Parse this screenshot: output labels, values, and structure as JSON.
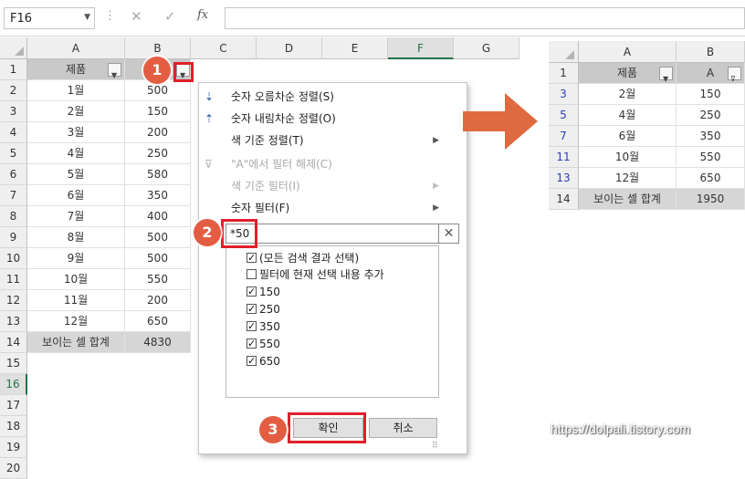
{
  "formula_bar": {
    "namebox": "F16",
    "fx": "fx",
    "formula": ""
  },
  "columns": [
    "A",
    "B",
    "C",
    "D",
    "E",
    "F",
    "G"
  ],
  "rows": [
    "1",
    "2",
    "3",
    "4",
    "5",
    "6",
    "7",
    "8",
    "9",
    "10",
    "11",
    "12",
    "13",
    "14",
    "15",
    "16",
    "17",
    "18",
    "19",
    "20"
  ],
  "table": {
    "header": [
      "제품",
      ""
    ],
    "products": [
      "1월",
      "2월",
      "3월",
      "4월",
      "5월",
      "6월",
      "7월",
      "8월",
      "9월",
      "10월",
      "11월",
      "12월"
    ],
    "values": [
      "500",
      "150",
      "200",
      "250",
      "580",
      "350",
      "400",
      "500",
      "500",
      "550",
      "200",
      "650"
    ],
    "total_label": "보이는 셀 합계",
    "total_value": "4830"
  },
  "filter_menu": {
    "items": [
      {
        "label": "숫자 오름차순 정렬(S)",
        "icon": "sort-ascending-icon"
      },
      {
        "label": "숫자 내림차순 정렬(O)",
        "icon": "sort-descending-icon"
      },
      {
        "label": "색 기준 정렬(T)",
        "icon": ""
      },
      {
        "label": "\"A\"에서 필터 해제(C)",
        "icon": "clear-filter-icon"
      },
      {
        "label": "색 기준 필터(I)",
        "icon": ""
      },
      {
        "label": "숫자 필터(F)",
        "icon": ""
      }
    ],
    "search_value": "*50",
    "clear_glyph": "✕",
    "list": [
      {
        "label": "(모든 검색 결과 선택)",
        "checked": true
      },
      {
        "label": "필터에 현재 선택 내용 추가",
        "checked": false
      },
      {
        "label": "150",
        "checked": true
      },
      {
        "label": "250",
        "checked": true
      },
      {
        "label": "350",
        "checked": true
      },
      {
        "label": "550",
        "checked": true
      },
      {
        "label": "650",
        "checked": true
      }
    ],
    "ok_label": "확인",
    "cancel_label": "취소"
  },
  "steps": [
    "1",
    "2",
    "3"
  ],
  "result": {
    "columns": [
      "A",
      "B"
    ],
    "rows": [
      "1",
      "3",
      "5",
      "7",
      "11",
      "13",
      "14"
    ],
    "header": [
      "제품",
      "A"
    ],
    "products": [
      "2월",
      "4월",
      "6월",
      "10월",
      "12월"
    ],
    "values": [
      "150",
      "250",
      "350",
      "550",
      "650"
    ],
    "total_label": "보이는 셀 합계",
    "total_value": "1950"
  },
  "watermark": "https://dolpali.tistory.com",
  "colors": {
    "highlight": "#e0202a",
    "step_badge": "#e35d42",
    "arrow": "#e06a40",
    "header_fill": "#c9c9c9"
  }
}
